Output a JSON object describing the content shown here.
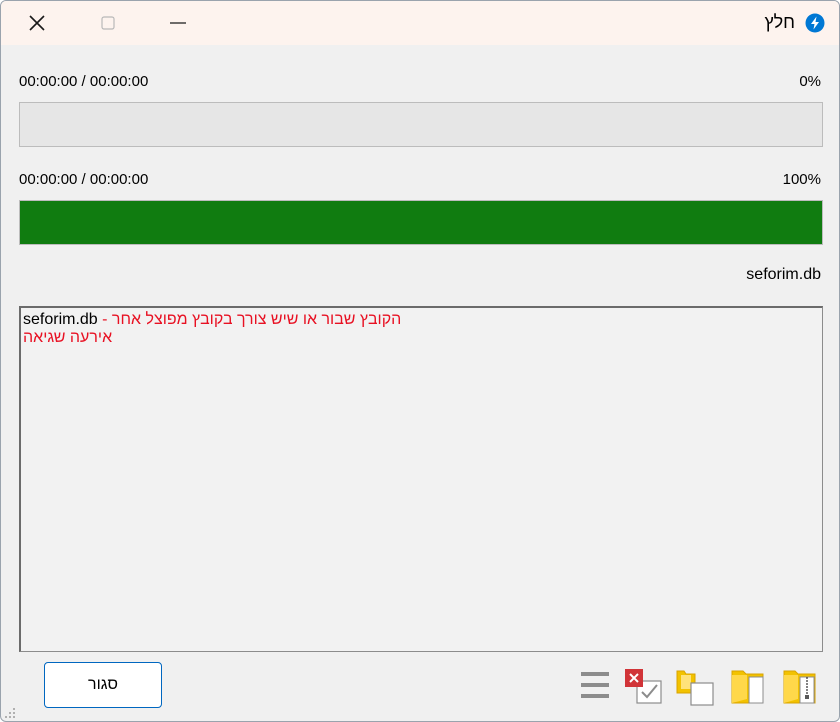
{
  "window": {
    "title": "חלץ",
    "icon": "lightning-bolt-icon",
    "accent": "#0078d4"
  },
  "progress": {
    "primary": {
      "time": "00:00:00 / 00:00:00",
      "percent_label": "0%",
      "value": 0
    },
    "secondary": {
      "time": "00:00:00 / 00:00:00",
      "percent_label": "100%",
      "value": 100,
      "fill_color": "#107c10"
    }
  },
  "current_file": "seforim.db",
  "log": {
    "line1_file": "seforim.db",
    "line1_separator": " - ",
    "line1_message": "הקובץ שבור או שיש צורך בקובץ מפוצל אחר",
    "line2_message": "אירעה שגיאה",
    "error_color": "#e81123"
  },
  "buttons": {
    "close_label": "סגור"
  },
  "toolbar": {
    "icons": [
      "menu-icon",
      "clear-errors-icon",
      "copy-icon",
      "open-folder-icon",
      "open-archive-icon"
    ]
  }
}
